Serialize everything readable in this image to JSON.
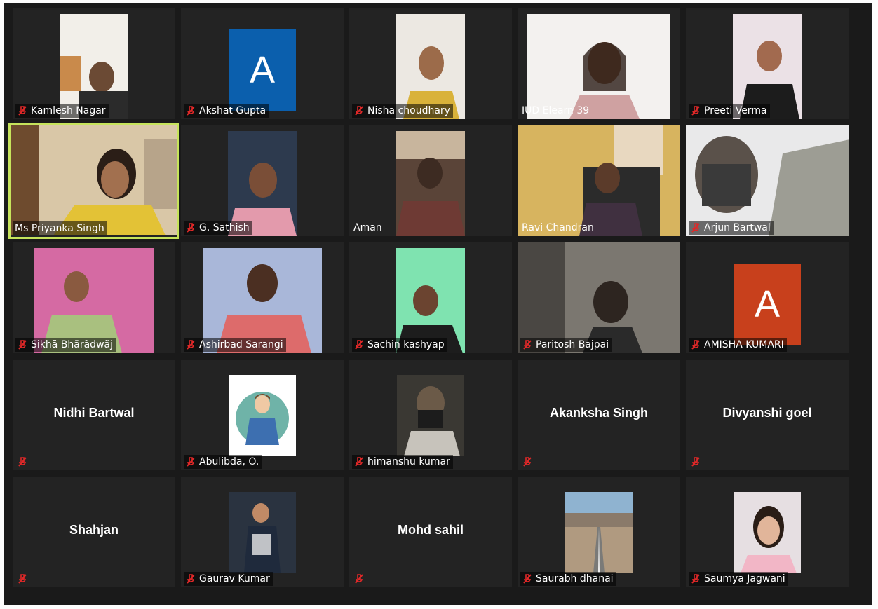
{
  "colors": {
    "window_bg": "#1a1a1a",
    "tile_bg": "#232323",
    "active_speaker_border": "#c6e35b",
    "muted_icon": "#e02828",
    "avatar_blue": "#0b5fad",
    "avatar_orange": "#c8401c"
  },
  "participants": [
    {
      "name": "Kamlesh Nagar",
      "muted": true
    },
    {
      "name": "Akshat Gupta",
      "muted": true,
      "avatar_letter": "A"
    },
    {
      "name": "Nisha choudhary",
      "muted": true
    },
    {
      "name": "IUD Elearn 39",
      "muted": false
    },
    {
      "name": "Preeti Verma",
      "muted": true
    },
    {
      "name": "Ms Priyanka Singh",
      "muted": false,
      "active_speaker": true
    },
    {
      "name": "G. Sathish",
      "muted": true
    },
    {
      "name": "Aman",
      "muted": false
    },
    {
      "name": "Ravi Chandran",
      "muted": false
    },
    {
      "name": "Arjun Bartwal",
      "muted": true
    },
    {
      "name": "Sikhã Bhãrãdwãj",
      "muted": true
    },
    {
      "name": "Ashirbad Sarangi",
      "muted": true
    },
    {
      "name": "Sachin kashyap",
      "muted": true
    },
    {
      "name": "Paritosh Bajpai",
      "muted": true
    },
    {
      "name": "AMISHA KUMARI",
      "muted": true,
      "avatar_letter": "A"
    },
    {
      "name": "Nidhi Bartwal",
      "muted": true,
      "video_off": true
    },
    {
      "name": "Abulibda, O.",
      "muted": true
    },
    {
      "name": "himanshu kumar",
      "muted": true
    },
    {
      "name": "Akanksha Singh",
      "muted": true,
      "video_off": true
    },
    {
      "name": "Divyanshi goel",
      "muted": true,
      "video_off": true
    },
    {
      "name": "Shahjan",
      "muted": true,
      "video_off": true
    },
    {
      "name": "Gaurav Kumar",
      "muted": true
    },
    {
      "name": "Mohd sahil",
      "muted": true,
      "video_off": true
    },
    {
      "name": "Saurabh dhanai",
      "muted": true
    },
    {
      "name": "Saumya Jagwani",
      "muted": true
    }
  ]
}
